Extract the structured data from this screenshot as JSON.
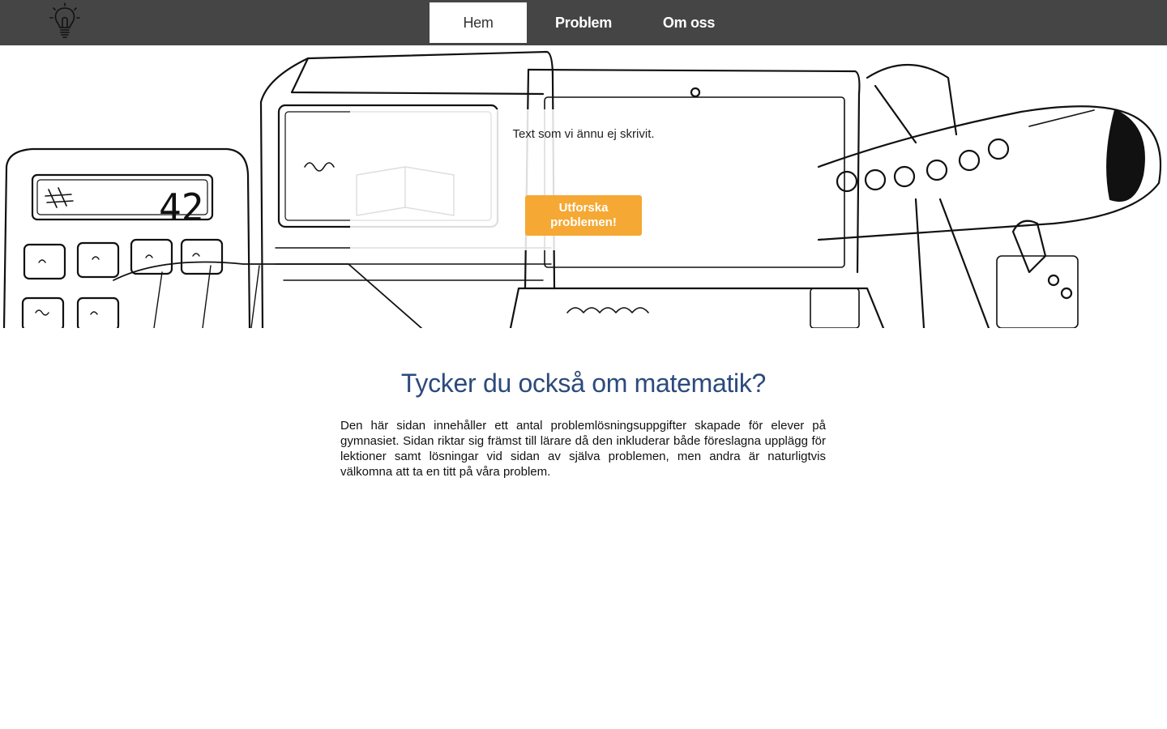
{
  "nav": {
    "logo_icon": "lightbulb-icon",
    "items": [
      {
        "label": "Hem",
        "active": true
      },
      {
        "label": "Problem",
        "active": false
      },
      {
        "label": "Om oss",
        "active": false
      }
    ]
  },
  "hero": {
    "calculator_display": "42",
    "card_text": "Text som vi ännu ej skrivit.",
    "cta_label": "Utforska problemen!"
  },
  "main": {
    "heading": "Tycker du också om matematik?",
    "intro": "Den här sidan innehåller ett antal problemlösningsuppgifter skapade för elever på gymnasiet. Sidan riktar sig främst till lärare då den inkluderar både föreslagna upplägg för lektioner samt lösningar vid sidan av själva problemen, men andra är naturligtvis välkomna att ta en titt på våra problem."
  },
  "colors": {
    "nav_bg": "#454545",
    "heading": "#2c4a7c",
    "cta": "#f5a833"
  }
}
